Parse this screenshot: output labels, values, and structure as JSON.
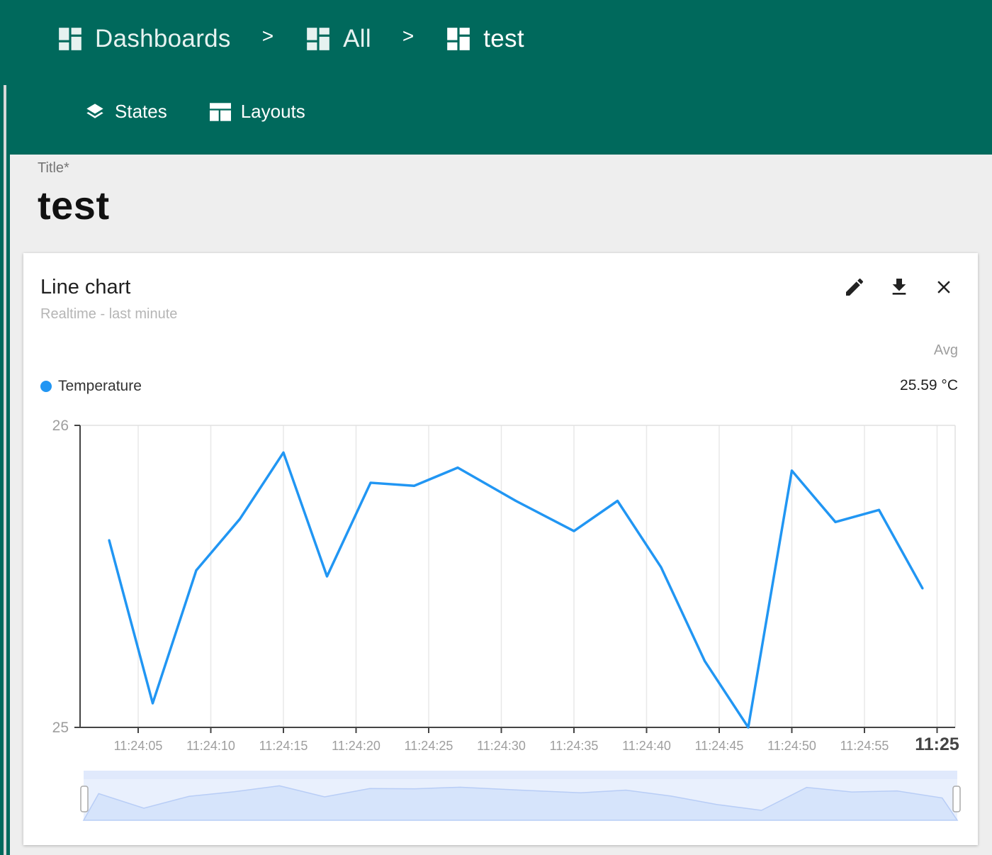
{
  "breadcrumb": [
    {
      "label": "Dashboards",
      "icon": "dashboard-icon"
    },
    {
      "label": "All",
      "icon": "dashboard-icon"
    },
    {
      "label": "test",
      "icon": "dashboard-icon"
    }
  ],
  "breadcrumb_separator": ">",
  "subnav": {
    "states_label": "States",
    "states_icon": "layers-icon",
    "layouts_label": "Layouts",
    "layouts_icon": "layout-icon"
  },
  "form": {
    "title_label": "Title*",
    "title_value": "test"
  },
  "widget": {
    "title": "Line chart",
    "subtitle": "Realtime - last minute",
    "actions": [
      {
        "name": "edit",
        "icon": "pencil-icon"
      },
      {
        "name": "download",
        "icon": "download-icon"
      },
      {
        "name": "close",
        "icon": "close-icon"
      }
    ],
    "avg_header": "Avg",
    "avg_value": "25.59 °C"
  },
  "colors": {
    "toolbar": "#00695c",
    "series": "#2196f3",
    "navigator_fill": "#d6e4fb"
  },
  "chart_data": {
    "type": "line",
    "xlabel": "",
    "ylabel": "",
    "ylim": [
      25,
      26
    ],
    "y_ticks": [
      "26",
      "25"
    ],
    "x_ticks": [
      "11:24:05",
      "11:24:10",
      "11:24:15",
      "11:24:20",
      "11:24:25",
      "11:24:30",
      "11:24:35",
      "11:24:40",
      "11:24:45",
      "11:24:50",
      "11:24:55",
      "11:25"
    ],
    "grid": true,
    "legend_position": "top-left",
    "navigator": true,
    "series": [
      {
        "name": "Temperature",
        "color": "#2196f3",
        "points": [
          [
            "11:24:03",
            25.62
          ],
          [
            "11:24:06",
            25.08
          ],
          [
            "11:24:09",
            25.52
          ],
          [
            "11:24:12",
            25.69
          ],
          [
            "11:24:15",
            25.91
          ],
          [
            "11:24:18",
            25.5
          ],
          [
            "11:24:21",
            25.81
          ],
          [
            "11:24:24",
            25.8
          ],
          [
            "11:24:27",
            25.86
          ],
          [
            "11:24:31",
            25.75
          ],
          [
            "11:24:35",
            25.65
          ],
          [
            "11:24:38",
            25.75
          ],
          [
            "11:24:41",
            25.53
          ],
          [
            "11:24:44",
            25.22
          ],
          [
            "11:24:47",
            25.0
          ],
          [
            "11:24:50",
            25.85
          ],
          [
            "11:24:53",
            25.68
          ],
          [
            "11:24:56",
            25.72
          ],
          [
            "11:24:59",
            25.46
          ]
        ]
      }
    ]
  }
}
